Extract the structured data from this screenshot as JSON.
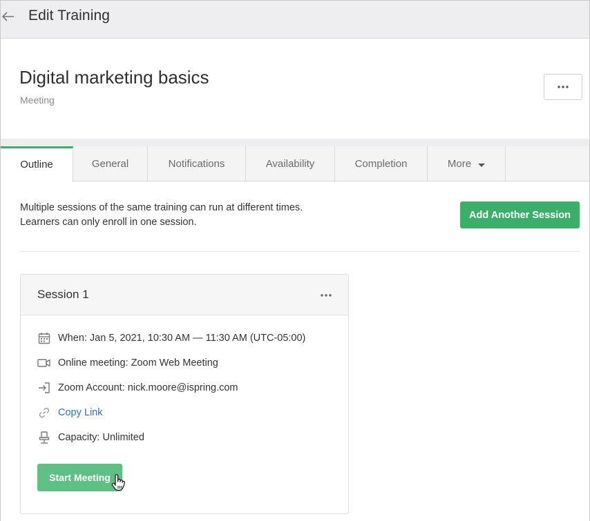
{
  "topbar": {
    "title": "Edit Training",
    "back_icon": "arrow-left-icon"
  },
  "training": {
    "title": "Digital marketing basics",
    "type": "Meeting",
    "more_icon": "ellipsis-icon"
  },
  "tabs": [
    {
      "label": "Outline",
      "active": true
    },
    {
      "label": "General",
      "active": false
    },
    {
      "label": "Notifications",
      "active": false
    },
    {
      "label": "Availability",
      "active": false
    },
    {
      "label": "Completion",
      "active": false
    },
    {
      "label": "More",
      "active": false
    }
  ],
  "outline": {
    "description_line1": "Multiple sessions of the same training can run at different times.",
    "description_line2": "Learners can only enroll in one session.",
    "add_session_label": "Add Another Session"
  },
  "session": {
    "title": "Session 1",
    "when": "When: Jan 5, 2021, 10:30 AM — 11:30 AM (UTC-05:00)",
    "online_meeting": "Online meeting: Zoom Web Meeting",
    "zoom_account": "Zoom Account: nick.moore@ispring.com",
    "copy_link": "Copy Link",
    "capacity": "Capacity: Unlimited",
    "start_label": "Start Meeting"
  },
  "colors": {
    "accent_green": "#3bae6a",
    "link_blue": "#2f6fc1"
  }
}
